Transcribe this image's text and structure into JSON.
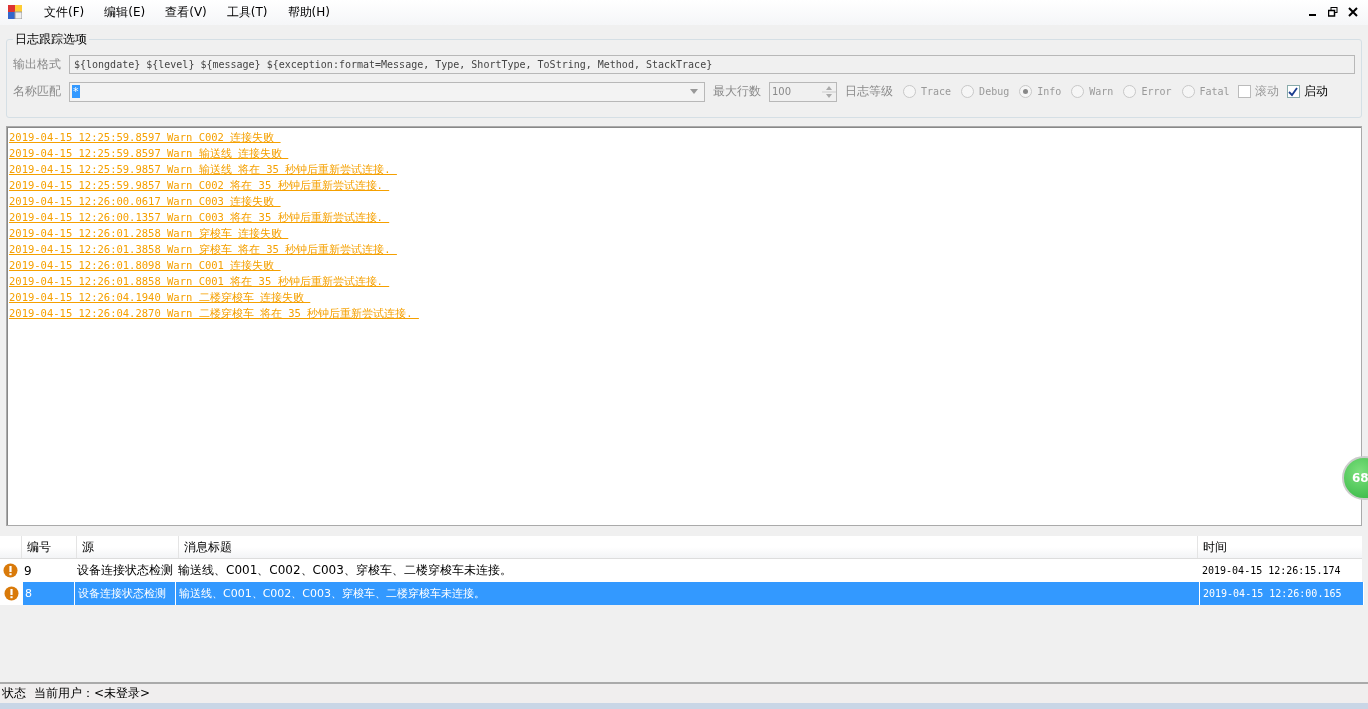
{
  "menu": [
    "文件(F)",
    "编辑(E)",
    "查看(V)",
    "工具(T)",
    "帮助(H)"
  ],
  "options": {
    "title": "日志跟踪选项",
    "format_label": "输出格式",
    "format_value": "${longdate} ${level} ${message} ${exception:format=Message, Type, ShortType, ToString, Method, StackTrace}",
    "name_label": "名称匹配",
    "name_value": "*",
    "max_label": "最大行数",
    "max_value": "100",
    "level_label": "日志等级",
    "levels": [
      {
        "label": "Trace",
        "selected": false
      },
      {
        "label": "Debug",
        "selected": false
      },
      {
        "label": "Info",
        "selected": true
      },
      {
        "label": "Warn",
        "selected": false
      },
      {
        "label": "Error",
        "selected": false
      },
      {
        "label": "Fatal",
        "selected": false
      }
    ],
    "checkboxes": [
      {
        "label": "滚动",
        "checked": false
      },
      {
        "label": "启动",
        "checked": true
      }
    ]
  },
  "log_lines": [
    "2019-04-15 12:25:59.8597 Warn C002 连接失败 ",
    "2019-04-15 12:25:59.8597 Warn 输送线 连接失败 ",
    "2019-04-15 12:25:59.9857 Warn 输送线 将在 35 秒钟后重新尝试连接. ",
    "2019-04-15 12:25:59.9857 Warn C002 将在 35 秒钟后重新尝试连接. ",
    "2019-04-15 12:26:00.0617 Warn C003 连接失败 ",
    "2019-04-15 12:26:00.1357 Warn C003 将在 35 秒钟后重新尝试连接. ",
    "2019-04-15 12:26:01.2858 Warn 穿梭车 连接失败 ",
    "2019-04-15 12:26:01.3858 Warn 穿梭车 将在 35 秒钟后重新尝试连接. ",
    "2019-04-15 12:26:01.8098 Warn C001 连接失败 ",
    "2019-04-15 12:26:01.8858 Warn C001 将在 35 秒钟后重新尝试连接. ",
    "2019-04-15 12:26:04.1940 Warn 二楼穿梭车 连接失败 ",
    "2019-04-15 12:26:04.2870 Warn 二楼穿梭车 将在 35 秒钟后重新尝试连接. "
  ],
  "badge": "68",
  "table": {
    "columns": [
      "编号",
      "源",
      "消息标题",
      "时间"
    ],
    "rows": [
      {
        "id": "9",
        "source": "设备连接状态检测",
        "title": "输送线、C001、C002、C003、穿梭车、二楼穿梭车未连接。",
        "time": "2019-04-15 12:26:15.174",
        "selected": false
      },
      {
        "id": "8",
        "source": "设备连接状态检测",
        "title": "输送线、C001、C002、C003、穿梭车、二楼穿梭车未连接。",
        "time": "2019-04-15 12:26:00.165",
        "selected": true
      }
    ]
  },
  "status_bar": {
    "label": "状态",
    "user": "当前用户：<未登录>"
  }
}
